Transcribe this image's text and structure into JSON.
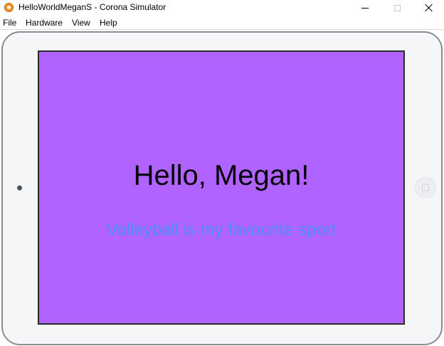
{
  "window": {
    "title": "HelloWorldMeganS - Corona Simulator",
    "app_icon": "corona-simulator-icon"
  },
  "menu": {
    "items": [
      "File",
      "Hardware",
      "View",
      "Help"
    ]
  },
  "app": {
    "background_color": "#b063ff",
    "greeting": "Hello, Megan!",
    "greeting_color": "#000000",
    "subtitle": "Volleyball is my favourite sport",
    "subtitle_color": "#4d8ff5"
  }
}
